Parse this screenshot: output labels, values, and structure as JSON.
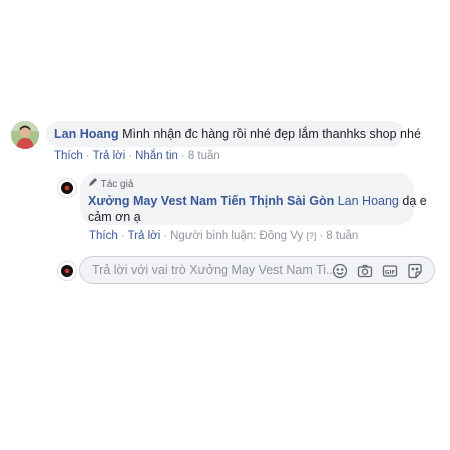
{
  "comment": {
    "author": "Lan Hoang",
    "text": "Mình nhận đc hàng rồi nhé đẹp lắm thanhks shop nhé",
    "actions": [
      "Thích",
      "Trả lời",
      "Nhắn tin"
    ],
    "time": "8 tuần"
  },
  "reply": {
    "author_badge": "Tác giả",
    "author": "Xưởng May Vest Nam Tiến Thịnh Sài Gòn",
    "mention": "Lan Hoang",
    "text_line1": "dạ e",
    "text_line2": "cảm ơn ạ",
    "actions": [
      "Thích",
      "Trả lời"
    ],
    "responder": "Người bình luận: Đông Vy",
    "bracket": "[?]",
    "time": "8 tuần"
  },
  "reply_input": {
    "placeholder": "Trả lời với vai trò Xưởng May Vest Nam Ti..."
  },
  "icons": [
    "emoji-icon",
    "camera-icon",
    "gif-icon",
    "sticker-icon"
  ],
  "colors": {
    "link": "#385898",
    "bubble": "#f2f3f5",
    "meta": "#90949c"
  }
}
